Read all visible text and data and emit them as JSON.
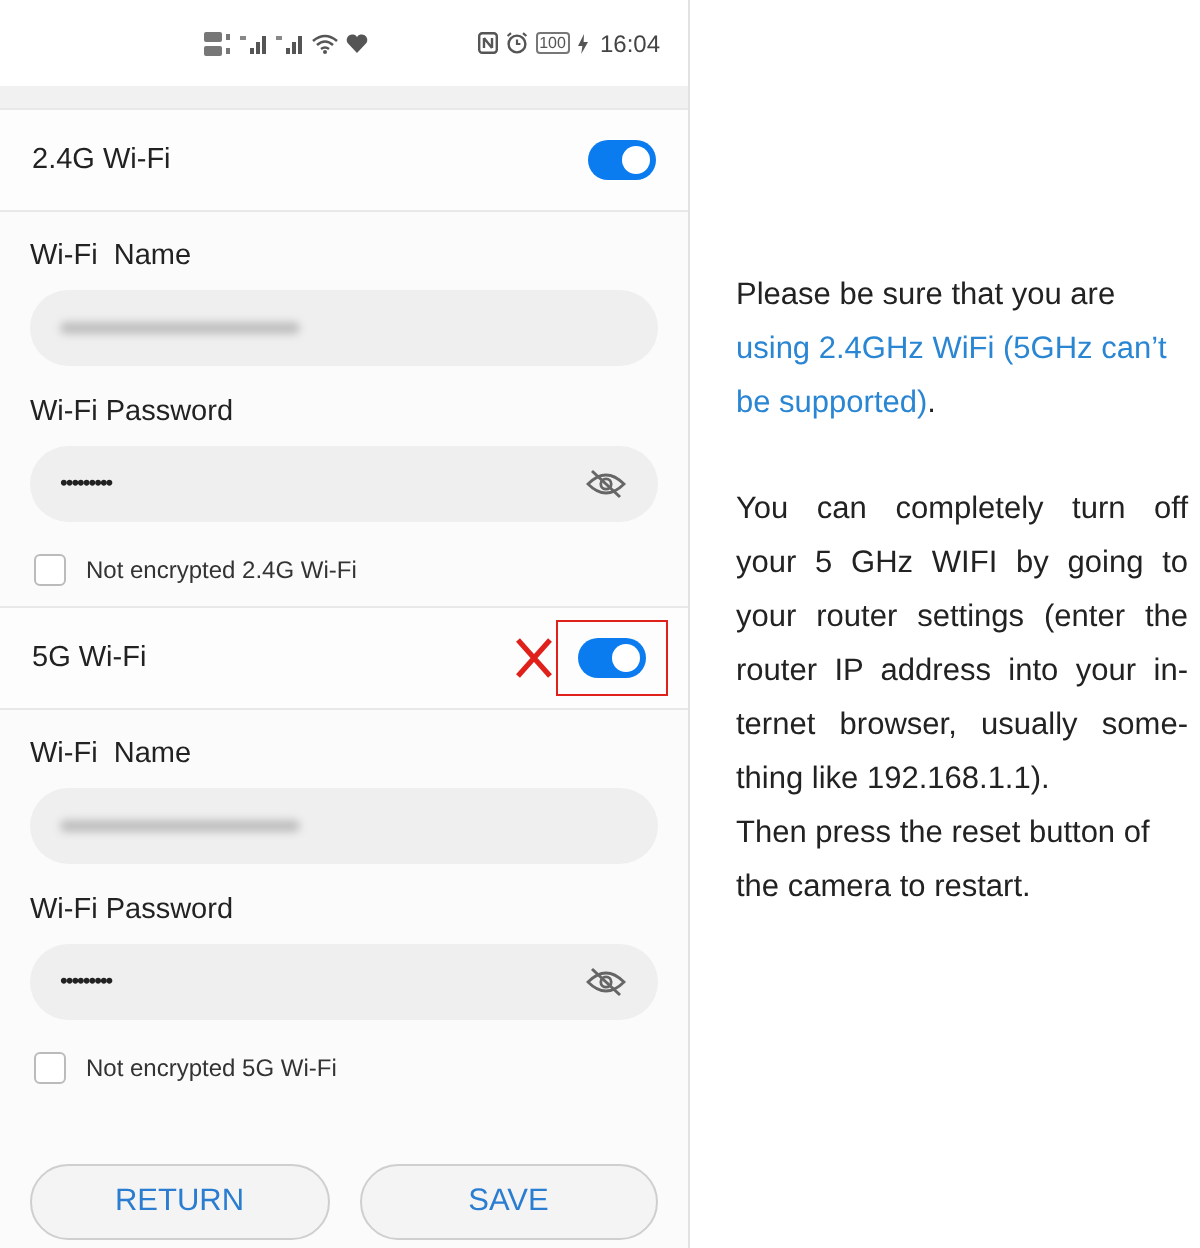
{
  "status_bar": {
    "battery": "100",
    "time": "16:04"
  },
  "networks": [
    {
      "title": "2.4G Wi-Fi",
      "enabled": true,
      "marked_wrong": false,
      "name_label": "Wi-Fi  Name",
      "name_redacted": true,
      "password_label": "Wi-Fi Password",
      "password": "•••••••••",
      "password_visible": false,
      "option": {
        "label": "Not encrypted 2.4G Wi-Fi",
        "checked": false
      }
    },
    {
      "title": "5G Wi-Fi",
      "enabled": true,
      "marked_wrong": true,
      "name_label": "Wi-Fi  Name",
      "name_redacted": true,
      "password_label": "Wi-Fi Password",
      "password": "•••••••••",
      "password_visible": false,
      "option": {
        "label": "Not encrypted 5G Wi-Fi",
        "checked": false
      }
    }
  ],
  "buttons": [
    "RETURN",
    "SAVE"
  ],
  "note": {
    "paragraphs": [
      {
        "kind": "mixed",
        "parts": [
          {
            "text": "Please be sure that you are ",
            "highlight": false
          },
          {
            "text": "using 2.4GHz WiFi (5GHz can’t be supported)",
            "highlight": true
          },
          {
            "text": ".",
            "highlight": false
          }
        ]
      },
      {
        "kind": "justified",
        "lines": [
          "You can completely turn off",
          "your 5 GHz WIFI by going to",
          "your router settings (enter the",
          "router IP address into your in-",
          "ternet browser, usually some-",
          "thing like 192.168.1.1)."
        ]
      },
      {
        "kind": "plain",
        "text": "Then press the reset button of the camera to restart."
      }
    ]
  }
}
